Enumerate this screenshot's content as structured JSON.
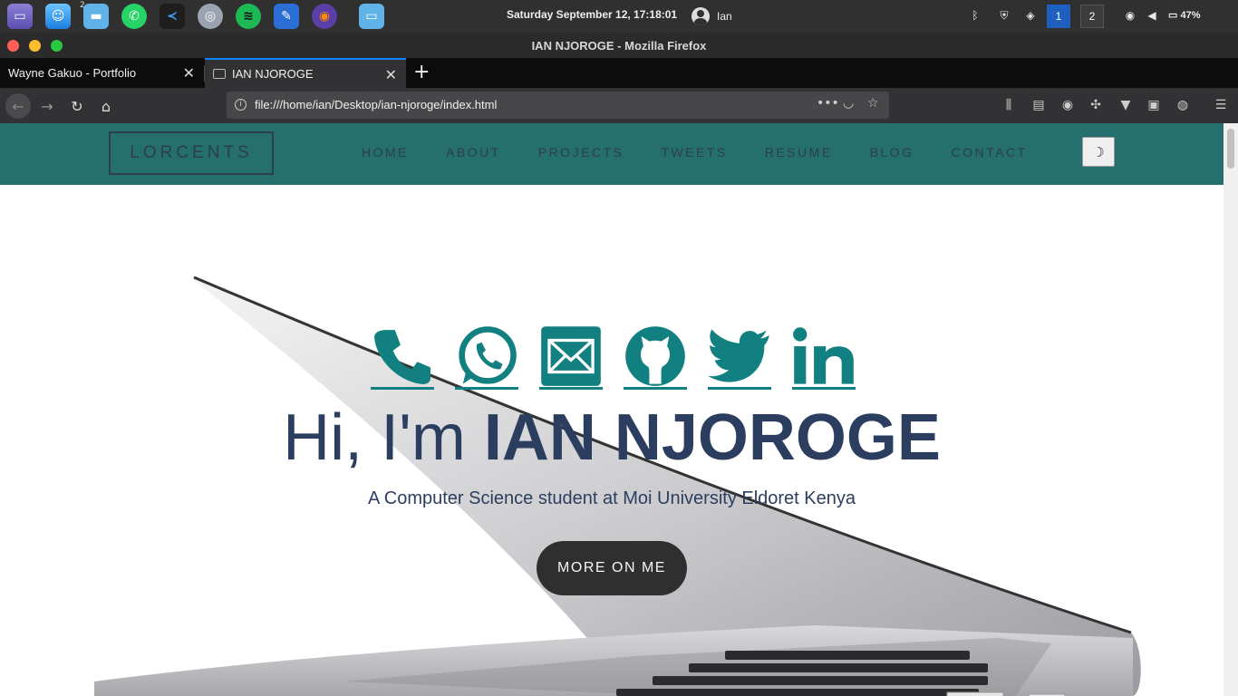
{
  "system_panel": {
    "clock": "Saturday September 12, 17:18:01",
    "user": "Ian",
    "files_badge": "2",
    "workspaces": [
      "1",
      "2"
    ],
    "battery": "47%",
    "dock_icons": [
      "terminal-icon",
      "finder-icon",
      "files-icon",
      "whatsapp-icon",
      "vscode-icon",
      "network-icon",
      "spotify-icon",
      "editor-icon",
      "firefox-icon",
      "folder-icon"
    ]
  },
  "window": {
    "title": "IAN NJOROGE - Mozilla Firefox"
  },
  "tabs": [
    {
      "label": "Wayne Gakuo - Portfolio",
      "active": false
    },
    {
      "label": "IAN NJOROGE",
      "active": true
    }
  ],
  "urlbar": {
    "url": "file:///home/ian/Desktop/ian-njoroge/index.html"
  },
  "site": {
    "logo": "LORCENTS",
    "nav": [
      "HOME",
      "ABOUT",
      "PROJECTS",
      "TWEETS",
      "RESUME",
      "BLOG",
      "CONTACT"
    ],
    "dark_toggle": "☽",
    "hero": {
      "greeting": "Hi, I'm",
      "name": "IAN NJOROGE",
      "subtitle": "A Computer Science student at Moi University Eldoret Kenya",
      "button": "MORE ON ME"
    },
    "socials": [
      "phone-icon",
      "whatsapp-icon",
      "email-icon",
      "github-icon",
      "twitter-icon",
      "linkedin-icon"
    ]
  },
  "colors": {
    "header": "#256f6e",
    "accent": "#128080",
    "text": "#2c3e5f",
    "button": "#2f2f2f"
  }
}
